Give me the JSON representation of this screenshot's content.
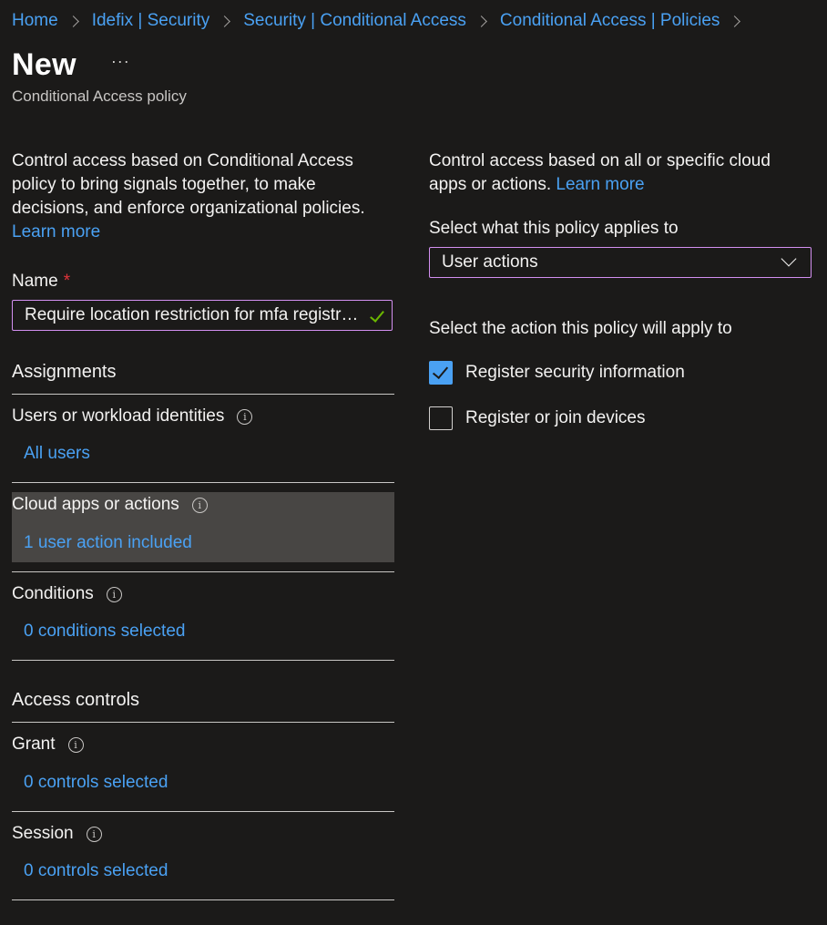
{
  "breadcrumb": [
    "Home",
    "Idefix | Security",
    "Security | Conditional Access",
    "Conditional Access | Policies"
  ],
  "header": {
    "title": "New",
    "more": "···",
    "subtitle": "Conditional Access policy"
  },
  "left": {
    "description": "Control access based on Conditional Access policy to bring signals together, to make decisions, and enforce organizational policies.",
    "learn_more": "Learn more",
    "name_label": "Name",
    "name_required": "*",
    "name_value": "Require location restriction for mfa registration"
  },
  "assignments": {
    "heading": "Assignments",
    "users": {
      "label": "Users or workload identities",
      "value": "All users"
    },
    "cloud": {
      "label": "Cloud apps or actions",
      "value": "1 user action included"
    },
    "conditions": {
      "label": "Conditions",
      "value": "0 conditions selected"
    }
  },
  "access_controls": {
    "heading": "Access controls",
    "grant": {
      "label": "Grant",
      "value": "0 controls selected"
    },
    "session": {
      "label": "Session",
      "value": "0 controls selected"
    }
  },
  "right": {
    "description": "Control access based on all or specific cloud apps or actions.",
    "learn_more": "Learn more",
    "applies_label": "Select what this policy applies to",
    "applies_value": "User actions",
    "action_label": "Select the action this policy will apply to",
    "actions": [
      {
        "label": "Register security information",
        "checked": true
      },
      {
        "label": "Register or join devices",
        "checked": false
      }
    ]
  },
  "colors": {
    "accent": "#4aa1f3",
    "focus_border": "#d38ff0",
    "required": "#e0343a",
    "valid": "#6bb700"
  }
}
